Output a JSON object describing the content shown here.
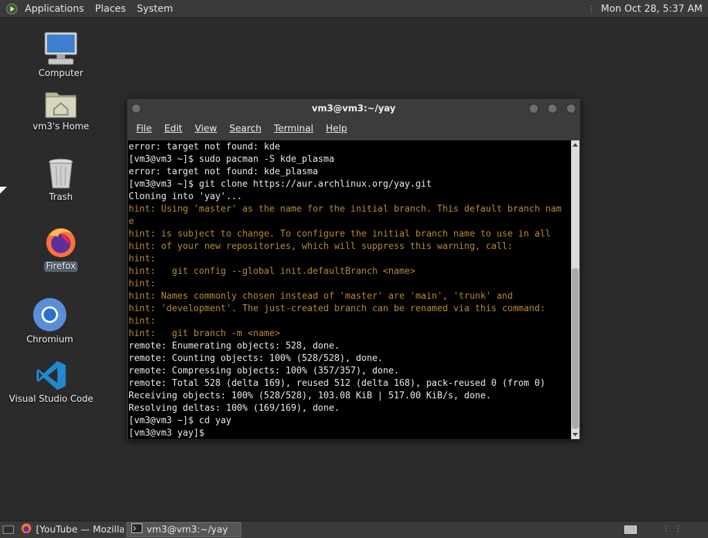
{
  "top_panel": {
    "menus": [
      "Applications",
      "Places",
      "System"
    ],
    "clock": "Mon Oct 28,  5:37 AM"
  },
  "desktop": {
    "icons": [
      {
        "label": "Computer",
        "icon": "computer-icon"
      },
      {
        "label": "vm3's Home",
        "icon": "home-folder-icon"
      },
      {
        "label": "Trash",
        "icon": "trash-icon"
      },
      {
        "label": "Firefox",
        "icon": "firefox-icon",
        "selected": true
      },
      {
        "label": "Chromium",
        "icon": "chromium-icon"
      },
      {
        "label": "Visual Studio Code",
        "icon": "vscode-icon"
      }
    ]
  },
  "terminal": {
    "title": "vm3@vm3:~/yay",
    "menu": [
      "File",
      "Edit",
      "View",
      "Search",
      "Terminal",
      "Help"
    ],
    "lines": [
      {
        "t": "error: target not found: kde",
        "c": "w"
      },
      {
        "t": "[vm3@vm3 ~]$ sudo pacman -S kde_plasma",
        "c": "w"
      },
      {
        "t": "error: target not found: kde_plasma",
        "c": "w"
      },
      {
        "t": "[vm3@vm3 ~]$ git clone https://aur.archlinux.org/yay.git",
        "c": "w"
      },
      {
        "t": "Cloning into 'yay'...",
        "c": "w"
      },
      {
        "t": "hint: Using 'master' as the name for the initial branch. This default branch nam",
        "c": "h"
      },
      {
        "t": "e",
        "c": "h"
      },
      {
        "t": "hint: is subject to change. To configure the initial branch name to use in all",
        "c": "h"
      },
      {
        "t": "hint: of your new repositories, which will suppress this warning, call:",
        "c": "h"
      },
      {
        "t": "hint:",
        "c": "h"
      },
      {
        "t": "hint:   git config --global init.defaultBranch <name>",
        "c": "h"
      },
      {
        "t": "hint:",
        "c": "h"
      },
      {
        "t": "hint: Names commonly chosen instead of 'master' are 'main', 'trunk' and",
        "c": "h"
      },
      {
        "t": "hint: 'development'. The just-created branch can be renamed via this command:",
        "c": "h"
      },
      {
        "t": "hint:",
        "c": "h"
      },
      {
        "t": "hint:   git branch -m <name>",
        "c": "h"
      },
      {
        "t": "remote: Enumerating objects: 528, done.",
        "c": "w"
      },
      {
        "t": "remote: Counting objects: 100% (528/528), done.",
        "c": "w"
      },
      {
        "t": "remote: Compressing objects: 100% (357/357), done.",
        "c": "w"
      },
      {
        "t": "remote: Total 528 (delta 169), reused 512 (delta 168), pack-reused 0 (from 0)",
        "c": "w"
      },
      {
        "t": "Receiving objects: 100% (528/528), 103.08 KiB | 517.00 KiB/s, done.",
        "c": "w"
      },
      {
        "t": "Resolving deltas: 100% (169/169), done.",
        "c": "w"
      },
      {
        "t": "[vm3@vm3 ~]$ cd yay",
        "c": "w"
      },
      {
        "t": "[vm3@vm3 yay]$",
        "c": "w"
      }
    ]
  },
  "taskbar": {
    "tasks": [
      {
        "label": "[YouTube — Mozilla...",
        "icon": "firefox-icon",
        "active": false
      },
      {
        "label": "vm3@vm3:~/yay",
        "icon": "terminal-icon",
        "active": true
      }
    ]
  }
}
